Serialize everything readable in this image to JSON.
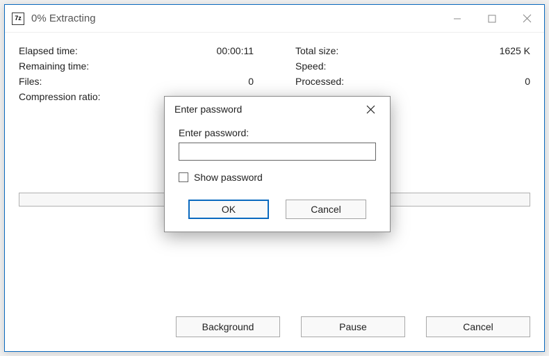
{
  "window": {
    "title": "0% Extracting",
    "app_icon_text": "7z"
  },
  "stats_left": {
    "elapsed_label": "Elapsed time:",
    "elapsed_value": "00:00:11",
    "remaining_label": "Remaining time:",
    "remaining_value": "",
    "files_label": "Files:",
    "files_value": "0",
    "ratio_label": "Compression ratio:",
    "ratio_value": ""
  },
  "stats_right": {
    "total_label": "Total size:",
    "total_value": "1625 K",
    "speed_label": "Speed:",
    "speed_value": "",
    "processed_label": "Processed:",
    "processed_value": "0",
    "packed_label": "",
    "packed_value": ""
  },
  "buttons": {
    "background": "Background",
    "pause": "Pause",
    "cancel": "Cancel"
  },
  "dialog": {
    "title": "Enter password",
    "field_label": "Enter password:",
    "password_value": "",
    "show_password_label": "Show password",
    "ok": "OK",
    "cancel": "Cancel"
  }
}
